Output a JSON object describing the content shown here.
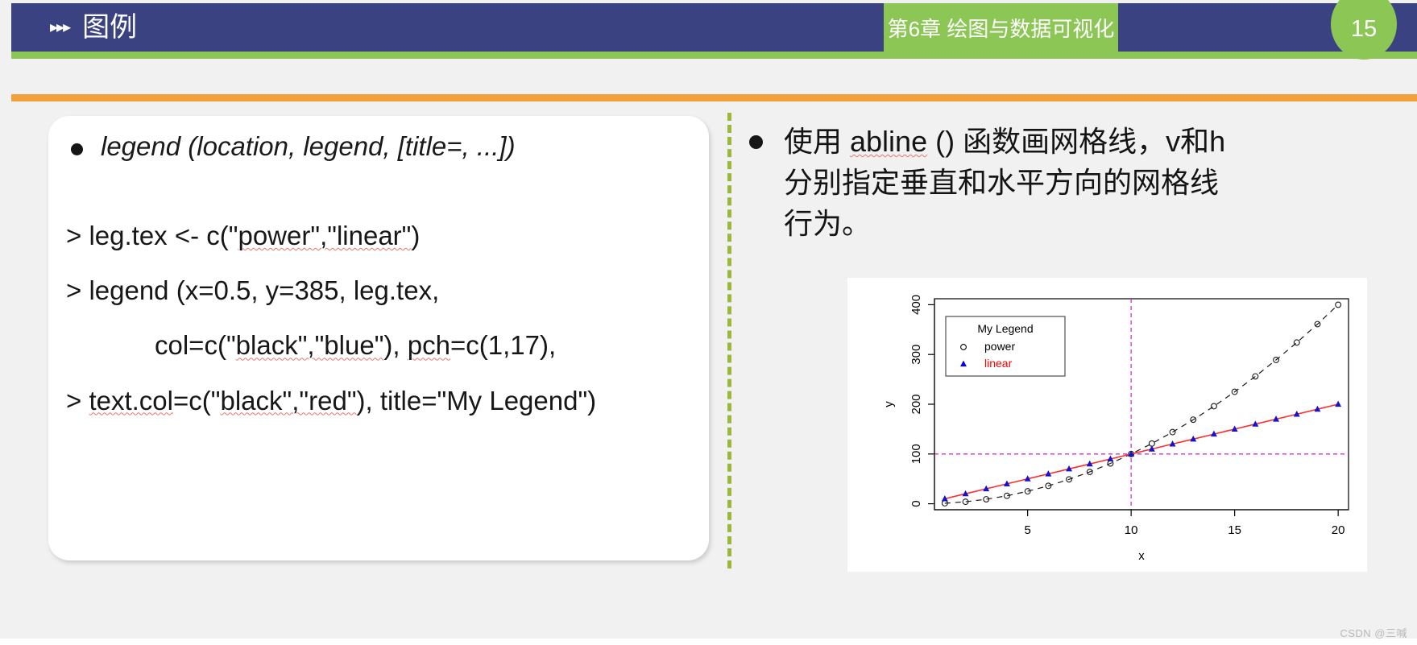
{
  "header": {
    "arrows_icon": "triple-right-arrow-icon",
    "arrows": "▸▸▸",
    "title": "图例",
    "chapter": "第6章 绘图与数据可视化",
    "page_number": "15",
    "colors": {
      "blue": "#3b4282",
      "green": "#8cc655",
      "orange": "#f2a03c"
    }
  },
  "left_panel": {
    "signature": "legend (location, legend, [title=, ...])",
    "code_lines": [
      {
        "indent": false,
        "parts": [
          {
            "t": "> leg.tex <- c(\"",
            "sq": false
          },
          {
            "t": "power\",\"linear\"",
            "sq": true
          },
          {
            "t": ")",
            "sq": false
          }
        ]
      },
      {
        "indent": false,
        "parts": [
          {
            "t": "> legend (x=0.5, y=385, leg.tex,",
            "sq": false
          }
        ]
      },
      {
        "indent": true,
        "parts": [
          {
            "t": "col=c(\"",
            "sq": false
          },
          {
            "t": "black\",\"blue\"",
            "sq": true
          },
          {
            "t": "), ",
            "sq": false
          },
          {
            "t": "pch",
            "sq": true
          },
          {
            "t": "=c(1,17),",
            "sq": false
          }
        ]
      },
      {
        "indent": false,
        "parts": [
          {
            "t": "> ",
            "sq": false
          },
          {
            "t": "text.col",
            "sq": true
          },
          {
            "t": "=c(\"",
            "sq": false
          },
          {
            "t": "black\",\"red\"",
            "sq": true
          },
          {
            "t": "), title=\"My Legend\")",
            "sq": false
          }
        ]
      }
    ]
  },
  "right_col": {
    "bullet_prefix": "使用 ",
    "bullet_fn": "abline",
    "bullet_rest": " () 函数画网格线，v和h分别指定垂直和水平方向的网格线行为。"
  },
  "chart_data": {
    "type": "line",
    "title": "",
    "xlabel": "x",
    "ylabel": "y",
    "xlim": [
      0.5,
      20.5
    ],
    "ylim": [
      -12,
      412
    ],
    "xticks": [
      5,
      10,
      15,
      20
    ],
    "yticks": [
      0,
      100,
      200,
      300,
      400
    ],
    "grid": false,
    "abline": {
      "v": 10,
      "h": 100,
      "color": "#cc33cc",
      "style": "dashed"
    },
    "legend": {
      "title": "My Legend",
      "position": "top-left",
      "entries": [
        {
          "label": "power",
          "pch": 1,
          "symbol": "open-circle",
          "col": "#000000",
          "text_col": "#000000"
        },
        {
          "label": "linear",
          "pch": 17,
          "symbol": "filled-triangle",
          "col": "#0000ee",
          "text_col": "#ff0000"
        }
      ]
    },
    "x": [
      1,
      2,
      3,
      4,
      5,
      6,
      7,
      8,
      9,
      10,
      11,
      12,
      13,
      14,
      15,
      16,
      17,
      18,
      19,
      20
    ],
    "series": [
      {
        "name": "power",
        "line_style": "dashed",
        "line_color": "#1a1a1a",
        "point_color": "#1a1a1a",
        "point_symbol": "open-circle",
        "values": [
          1,
          4,
          9,
          16,
          25,
          36,
          49,
          64,
          81,
          100,
          121,
          144,
          169,
          196,
          225,
          256,
          289,
          324,
          361,
          400
        ]
      },
      {
        "name": "linear",
        "line_style": "solid",
        "line_color": "#ff2d2d",
        "point_color": "#1414cc",
        "point_symbol": "filled-triangle",
        "values": [
          10,
          20,
          30,
          40,
          50,
          60,
          70,
          80,
          90,
          100,
          110,
          120,
          130,
          140,
          150,
          160,
          170,
          180,
          190,
          200
        ]
      }
    ]
  },
  "watermark": "CSDN @三喊"
}
